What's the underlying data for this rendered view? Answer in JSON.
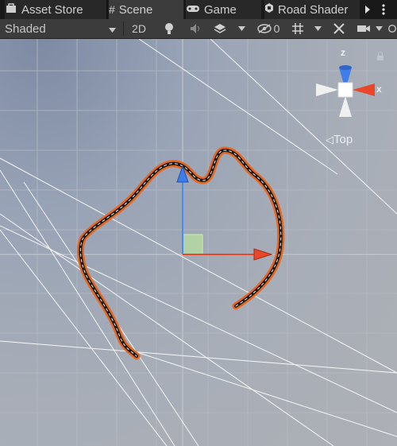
{
  "tabs": [
    {
      "label": "Asset Store",
      "icon": "store-icon"
    },
    {
      "label": "Scene",
      "icon": "grid-icon",
      "active": true
    },
    {
      "label": "Game",
      "icon": "gamepad-icon"
    },
    {
      "label": "Road Shader",
      "icon": "shader-icon"
    }
  ],
  "toolbar": {
    "shading_mode": "Shaded",
    "mode_2d": "2D",
    "hidden_count": "0"
  },
  "gizmo": {
    "y_label": "z",
    "x_label": "x",
    "view_label": "Top"
  },
  "colors": {
    "road": "#e8661e",
    "x_axis": "#e8472a",
    "z_axis": "#3f7ee8",
    "grid": "#bcc1c9"
  }
}
